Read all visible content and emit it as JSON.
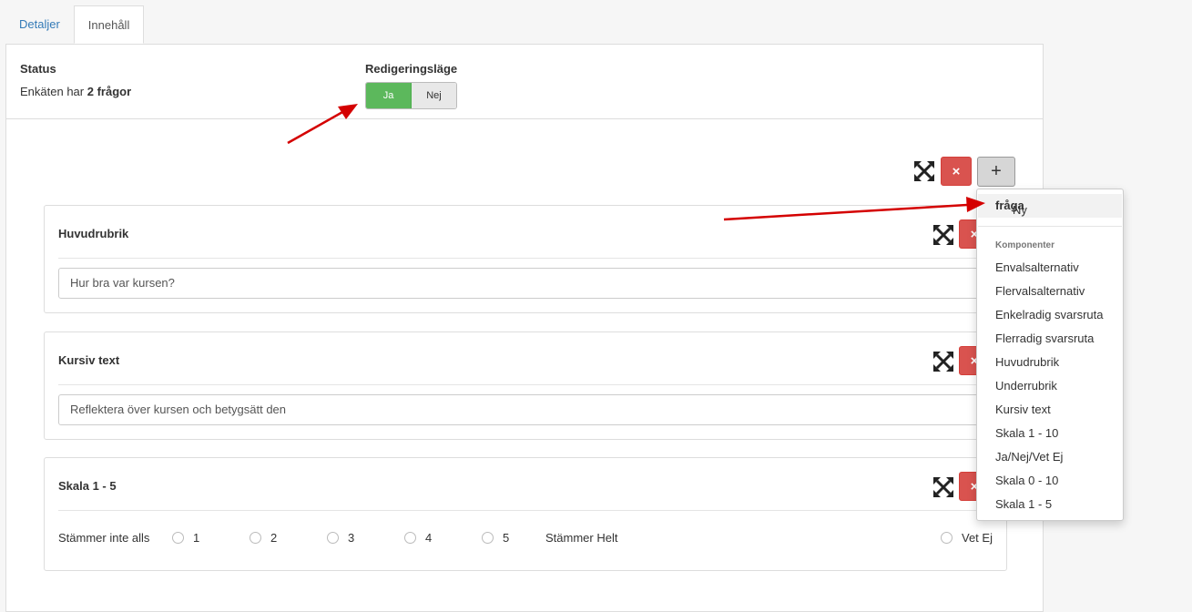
{
  "tabs": [
    {
      "label": "Detaljer"
    },
    {
      "label": "Innehåll"
    }
  ],
  "status": {
    "title": "Status",
    "text_prefix": "Enkäten har",
    "text_bold": "2 frågor"
  },
  "edit_mode": {
    "title": "Redigeringsläge",
    "yes_label": "Ja",
    "no_label": "Nej",
    "selected": "Ja"
  },
  "toolbar": {
    "expand_icon": "expand-arrows-icon",
    "delete_symbol": "×",
    "add_symbol": "+"
  },
  "cards": [
    {
      "title": "Huvudrubrik",
      "input_value": "Hur bra var kursen?"
    },
    {
      "title": "Kursiv text",
      "input_value": "Reflektera över kursen och betygsätt den"
    },
    {
      "title": "Skala 1 - 5",
      "scale_left": "Stämmer inte alls",
      "scale_right": "Stämmer Helt",
      "options": [
        "1",
        "2",
        "3",
        "4",
        "5"
      ],
      "extra_option": "Vet Ej"
    }
  ],
  "dropdown": {
    "new_prefix": "Ny",
    "new_bold": "fråga",
    "section_header": "Komponenter",
    "items": [
      "Envalsalternativ",
      "Flervalsalternativ",
      "Enkelradig svarsruta",
      "Flerradig svarsruta",
      "Huvudrubrik",
      "Underrubrik",
      "Kursiv text",
      "Skala 1 - 10",
      "Ja/Nej/Vet Ej",
      "Skala 0 - 10",
      "Skala 1 - 5"
    ]
  },
  "colors": {
    "toggle_active": "#5cb85c",
    "delete_button": "#d9534f",
    "link": "#337ab7",
    "annotation_arrow": "#d40000"
  }
}
